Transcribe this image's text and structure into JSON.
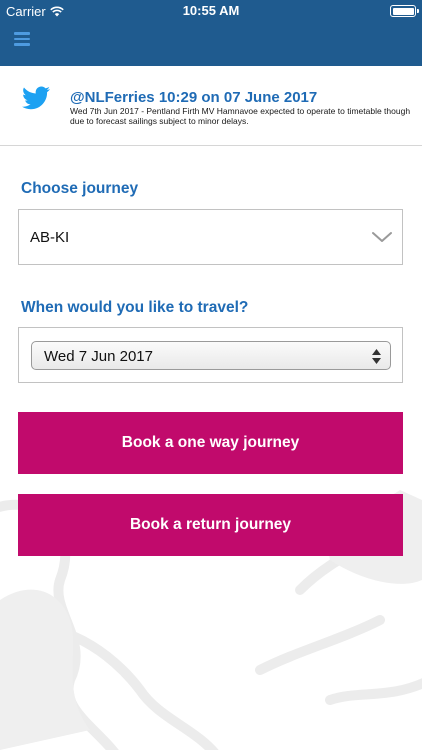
{
  "status_bar": {
    "carrier": "Carrier",
    "time": "10:55 AM"
  },
  "header": {
    "menu_icon": "hamburger-menu-icon",
    "background_color": "#1f5b8f"
  },
  "tweet": {
    "icon": "twitter-bird-icon",
    "title": "@NLFerries 10:29 on 07 June 2017",
    "text": "Wed 7th Jun 2017 - Pentland Firth MV Hamnavoe expected to operate to timetable though due to forecast sailings subject to minor delays."
  },
  "journey": {
    "label": "Choose journey",
    "selected": "AB-KI",
    "icon": "chevron-down-icon"
  },
  "travel": {
    "label": "When would you like to travel?",
    "selected_date": "Wed 7 Jun 2017",
    "icon": "stepper-arrows-icon"
  },
  "buttons": {
    "one_way": "Book a one way journey",
    "return": "Book a return journey",
    "color": "#c10a6c"
  },
  "colors": {
    "accent": "#1f6bb5"
  }
}
